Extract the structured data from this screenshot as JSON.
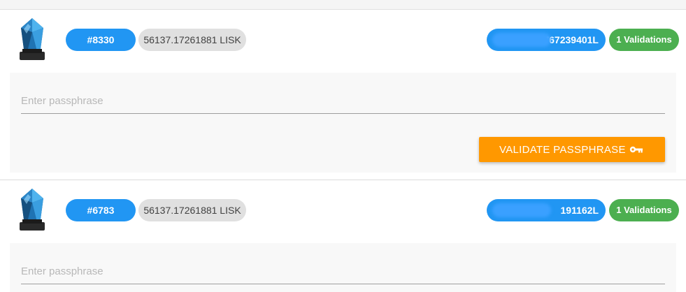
{
  "colors": {
    "id_pill": "#2196f3",
    "amount_pill": "#e0e0e0",
    "validations_pill": "#4caf50",
    "validate_button": "#ff9800"
  },
  "delegates": [
    {
      "id_label": "#8330",
      "amount": "56137.17261881 LISK",
      "address_visible_suffix": "767239401L",
      "validations": "1 Validations",
      "passphrase_placeholder": "Enter passphrase",
      "passphrase_value": "",
      "validate_label": "VALIDATE PASSPHRASE",
      "validate_icon": "key-icon",
      "avatar_icon": "lisk-crystal-icon"
    },
    {
      "id_label": "#6783",
      "amount": "56137.17261881 LISK",
      "address_visible_suffix": "191162L",
      "validations": "1 Validations",
      "passphrase_placeholder": "Enter passphrase",
      "passphrase_value": "",
      "avatar_icon": "lisk-crystal-icon"
    }
  ]
}
